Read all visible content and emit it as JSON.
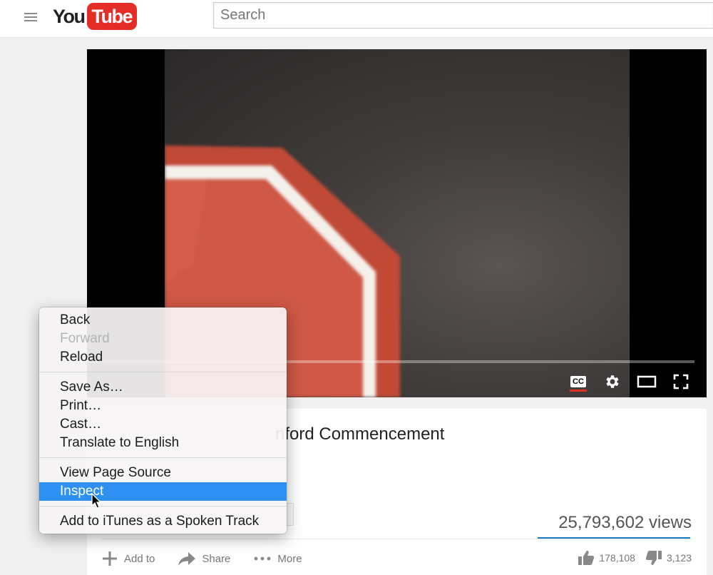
{
  "header": {
    "logo_you": "You",
    "logo_tube": "Tube",
    "search_placeholder": "Search"
  },
  "video": {
    "title_visible": "nford Commencement",
    "views": "25,793,602 views",
    "controls": [
      "closed-captions",
      "settings",
      "theater-mode",
      "fullscreen"
    ],
    "cc_label": "CC"
  },
  "actions": {
    "add_to": "Add to",
    "share": "Share",
    "more": "More"
  },
  "ratings": {
    "likes": "178,108",
    "dislikes": "3,123"
  },
  "context_menu": {
    "groups": [
      [
        {
          "label": "Back"
        },
        {
          "label": "Forward",
          "disabled": true
        },
        {
          "label": "Reload"
        }
      ],
      [
        {
          "label": "Save As…"
        },
        {
          "label": "Print…"
        },
        {
          "label": "Cast…"
        },
        {
          "label": "Translate to English"
        }
      ],
      [
        {
          "label": "View Page Source"
        },
        {
          "label": "Inspect",
          "selected": true
        }
      ],
      [
        {
          "label": "Add to iTunes as a Spoken Track"
        }
      ]
    ]
  },
  "colors": {
    "brand_red": "#e52d27",
    "menu_selection": "#2e90f0",
    "views_bar": "#167ac6",
    "stop_sign_red": "#c8503e"
  }
}
